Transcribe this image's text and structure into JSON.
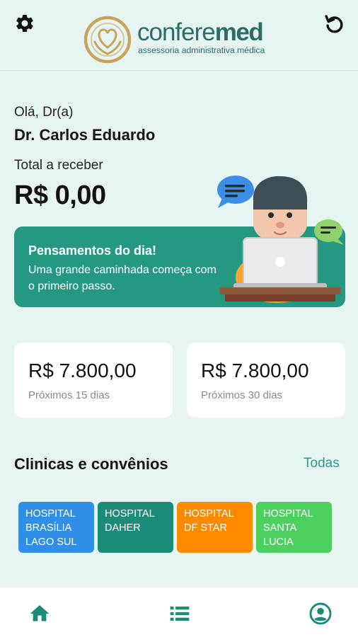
{
  "header": {
    "logo_brand_light": "confere",
    "logo_brand_bold": "med",
    "logo_tagline": "assessoria administrativa médica",
    "settings_icon": "gear-icon",
    "refresh_icon": "refresh-icon"
  },
  "greeting": {
    "salutation": "Olá, Dr(a)",
    "doctor_name": "Dr. Carlos Eduardo",
    "total_label": "Total a receber",
    "total_value": "R$ 0,00"
  },
  "banner": {
    "title": "Pensamentos do dia!",
    "message": "Uma grande caminhada começa com o primeiro passo."
  },
  "stats": [
    {
      "value": "R$ 7.800,00",
      "label": "Próximos 15 dias"
    },
    {
      "value": "R$ 7.800,00",
      "label": "Próximos 30 dias"
    }
  ],
  "clinics_section": {
    "title": "Clinicas e convênios",
    "see_all": "Todas",
    "items": [
      {
        "name": "HOSPITAL\nBRASÍLIA\nLAGO SUL",
        "color": "#2f8fe8"
      },
      {
        "name": "HOSPITAL\nDAHER",
        "color": "#1c8c78"
      },
      {
        "name": "HOSPITAL\nDF STAR",
        "color": "#ff8a00"
      },
      {
        "name": "HOSPITAL\nSANTA\nLUCIA",
        "color": "#4cd160"
      }
    ]
  },
  "bottom_nav": [
    {
      "icon": "home-icon"
    },
    {
      "icon": "list-icon"
    },
    {
      "icon": "user-icon"
    }
  ],
  "colors": {
    "background": "#e6f4f2",
    "primary": "#259882",
    "brand_text": "#2a6e67",
    "accent_link": "#2f9a86"
  }
}
